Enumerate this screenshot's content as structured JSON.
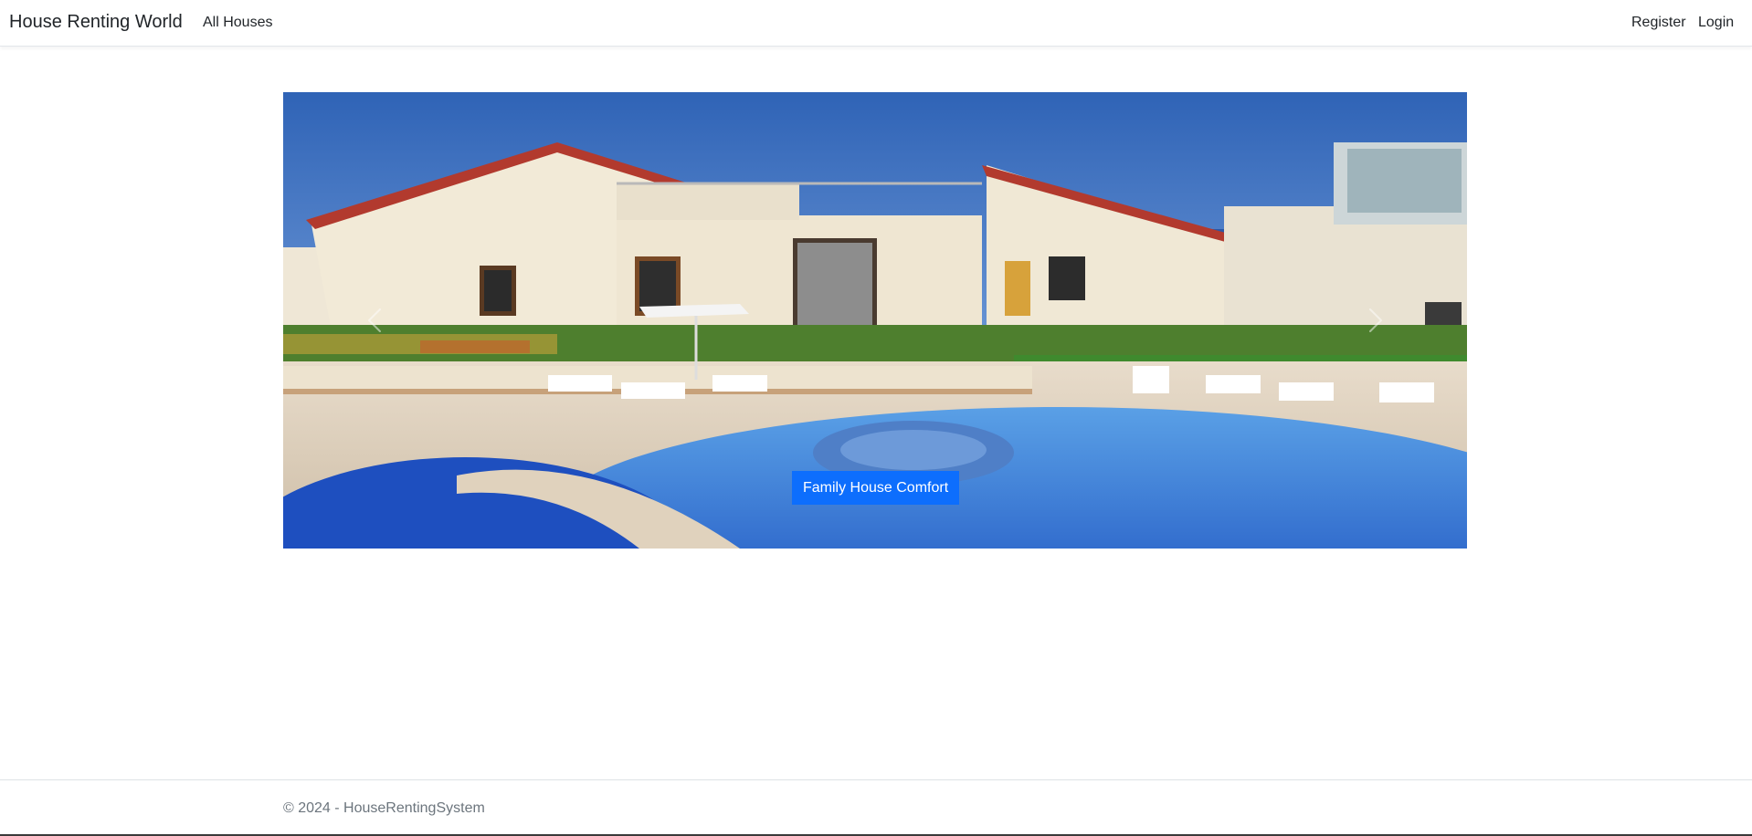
{
  "navbar": {
    "brand": "House Renting World",
    "links": {
      "all_houses": "All Houses",
      "register": "Register",
      "login": "Login"
    }
  },
  "carousel": {
    "active_slide": {
      "caption": "Family House Comfort"
    },
    "controls": {
      "prev_icon": "chevron-left-icon",
      "next_icon": "chevron-right-icon"
    }
  },
  "footer": {
    "text": "© 2024 - HouseRentingSystem"
  },
  "colors": {
    "accent": "#0d6efd",
    "text": "#212529",
    "muted": "#6c757d"
  }
}
